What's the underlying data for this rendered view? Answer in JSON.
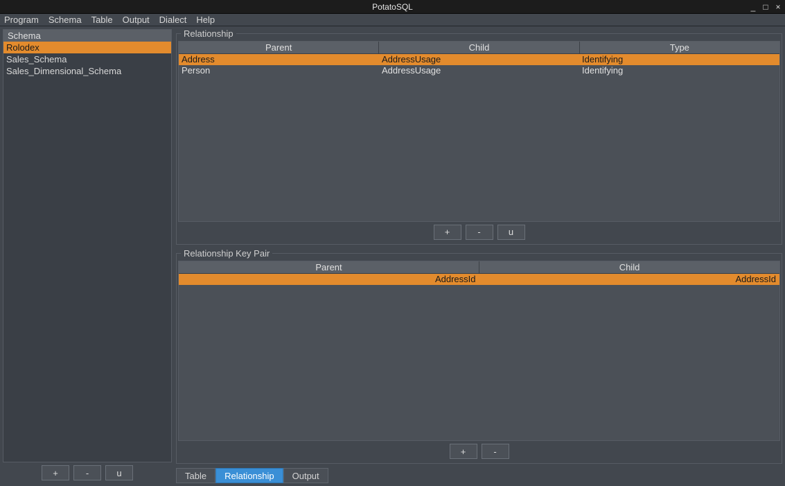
{
  "window": {
    "title": "PotatoSQL"
  },
  "menu": [
    "Program",
    "Schema",
    "Table",
    "Output",
    "Dialect",
    "Help"
  ],
  "sidebar": {
    "title": "Schema",
    "items": [
      {
        "label": "Rolodex",
        "selected": true
      },
      {
        "label": "Sales_Schema",
        "selected": false
      },
      {
        "label": "Sales_Dimensional_Schema",
        "selected": false
      }
    ],
    "buttons": {
      "add": "+",
      "remove": "-",
      "update": "u"
    }
  },
  "tabs": [
    {
      "label": "Table",
      "active": false
    },
    {
      "label": "Relationship",
      "active": true
    },
    {
      "label": "Output",
      "active": false
    }
  ],
  "relationship_panel": {
    "title": "Relationship",
    "columns": [
      "Parent",
      "Child",
      "Type"
    ],
    "rows": [
      {
        "cells": [
          "Address",
          "AddressUsage",
          "Identifying"
        ],
        "selected": true
      },
      {
        "cells": [
          "Person",
          "AddressUsage",
          "Identifying"
        ],
        "selected": false
      }
    ],
    "buttons": {
      "add": "+",
      "remove": "-",
      "update": "u"
    }
  },
  "keypair_panel": {
    "title": "Relationship Key Pair",
    "columns": [
      "Parent",
      "Child"
    ],
    "rows": [
      {
        "cells": [
          "AddressId",
          "AddressId"
        ],
        "selected": true
      }
    ],
    "buttons": {
      "add": "+",
      "remove": "-"
    }
  }
}
